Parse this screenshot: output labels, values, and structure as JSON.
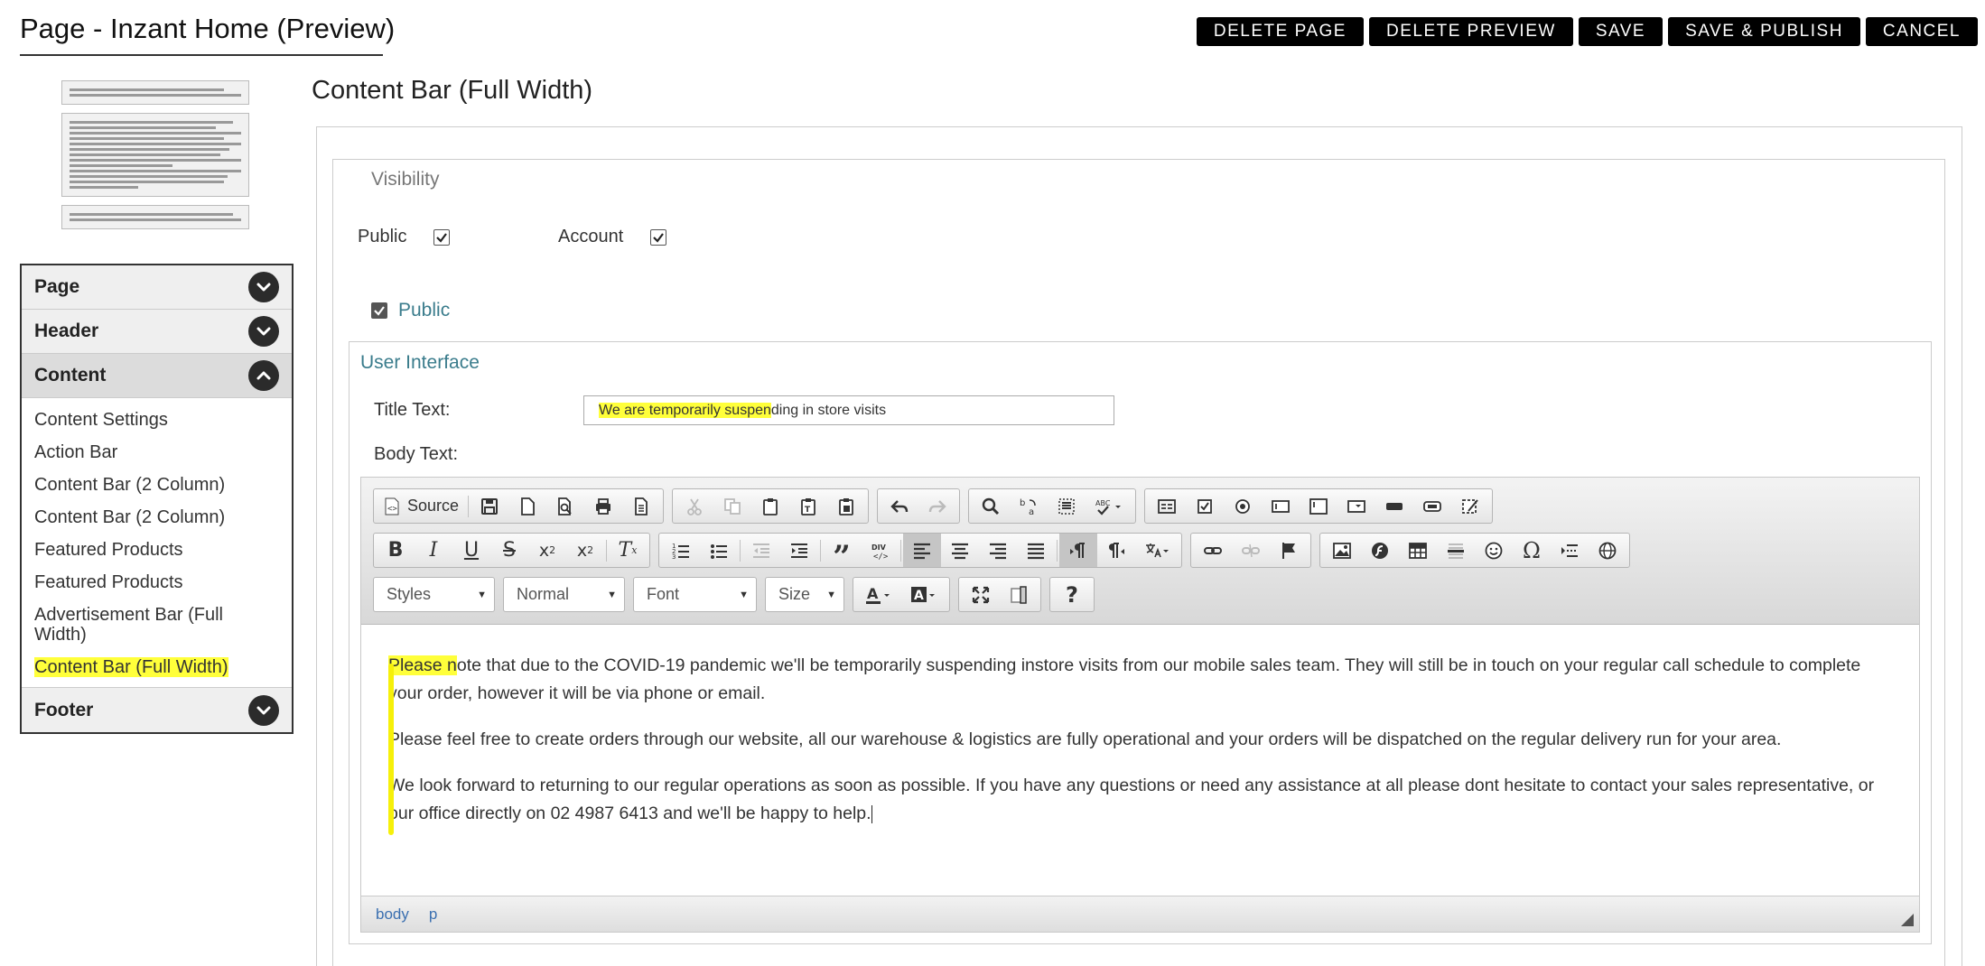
{
  "page": {
    "title": "Page - Inzant Home (Preview)",
    "actions": [
      "DELETE PAGE",
      "DELETE PREVIEW",
      "SAVE",
      "SAVE & PUBLISH",
      "CANCEL"
    ]
  },
  "sidebar": {
    "sections": [
      {
        "label": "Page",
        "expanded": false
      },
      {
        "label": "Header",
        "expanded": false
      },
      {
        "label": "Content",
        "expanded": true
      },
      {
        "label": "Footer",
        "expanded": false
      }
    ],
    "content_items": [
      "Content Settings",
      "Action Bar",
      "Content Bar (2 Column)",
      "Content Bar (2 Column)",
      "Featured Products",
      "Featured Products",
      "Advertisement Bar (Full Width)",
      "Content Bar (Full Width)"
    ],
    "selected_item": "Content Bar (Full Width)"
  },
  "main": {
    "section_title": "Content Bar (Full Width)",
    "visibility_label": "Visibility",
    "visibility": {
      "public_label": "Public",
      "public_checked": true,
      "account_label": "Account",
      "account_checked": true
    },
    "public_toggle_label": "Public",
    "ui_label": "User Interface",
    "title_text_label": "Title Text:",
    "title_text_value": "We are temporarily suspending in store visits",
    "title_text_highlight": "We are temporarily suspen",
    "title_text_rest": "ding in store visits",
    "body_text_label": "Body Text:"
  },
  "editor": {
    "source_label": "Source",
    "styles_label": "Styles",
    "format_label": "Normal",
    "font_label": "Font",
    "size_label": "Size",
    "paragraphs": [
      {
        "highlight": "Please n",
        "text": "ote that due to the COVID-19 pandemic we'll be temporarily suspending instore visits from our mobile sales team. They will still be in touch on your regular call schedule to complete your order, however it will be via phone or email."
      },
      {
        "highlight": "",
        "text": "Please feel free to create orders through our website, all our warehouse & logistics are fully operational and your orders will be dispatched on the regular delivery run for your area."
      },
      {
        "highlight": "",
        "text": "We look forward to returning to our regular operations as soon as possible. If you have any questions or need any assistance at all please dont hesitate to contact your sales representative, or our office directly on 02 4987 6413 and we'll be happy to help."
      }
    ],
    "path": [
      "body",
      "p"
    ]
  },
  "colors": {
    "highlight": "#ffff3a",
    "accent_text": "#3a7c8c",
    "button_bg": "#000000"
  }
}
